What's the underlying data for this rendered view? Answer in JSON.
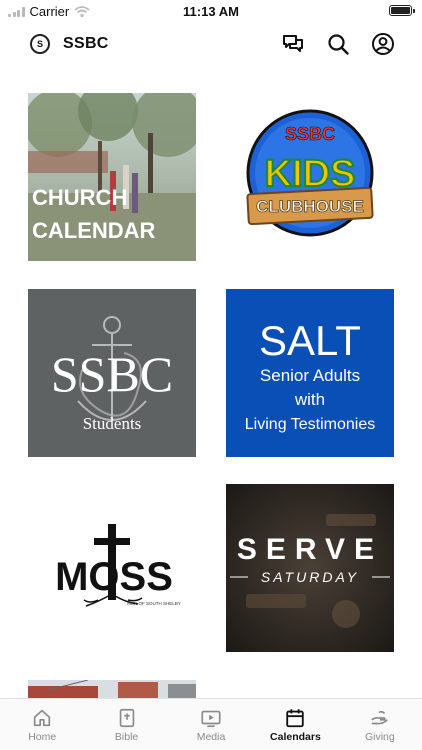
{
  "status_bar": {
    "carrier": "Carrier",
    "time": "11:13 AM"
  },
  "header": {
    "title": "SSBC",
    "logo_text": "S"
  },
  "tiles": {
    "church_calendar": {
      "line1": "CHURCH",
      "line2": "CALENDAR"
    },
    "kids_clubhouse": {
      "top": "SSBC",
      "middle": "KIDS",
      "bottom": "CLUBHOUSE"
    },
    "students": {
      "title": "SSBC",
      "subtitle": "Students"
    },
    "salt": {
      "title": "SALT",
      "line1": "Senior Adults",
      "line2": "with",
      "line3": "Living Testimonies"
    },
    "moss": {
      "title": "MOSS",
      "caption": "MEN OF SOUTH SHELBY"
    },
    "serve": {
      "title": "SERVE",
      "subtitle": "SATURDAY"
    }
  },
  "tabs": [
    {
      "label": "Home",
      "icon": "home-icon"
    },
    {
      "label": "Bible",
      "icon": "bible-icon"
    },
    {
      "label": "Media",
      "icon": "media-icon"
    },
    {
      "label": "Calendars",
      "icon": "calendar-icon",
      "active": true
    },
    {
      "label": "Giving",
      "icon": "giving-icon"
    }
  ],
  "colors": {
    "salt_blue": "#0a4fb5",
    "students_gray": "#5f6262",
    "kids_blue": "#1c62d6",
    "active_tab": "#111111",
    "inactive_tab": "#8a8a8a"
  }
}
